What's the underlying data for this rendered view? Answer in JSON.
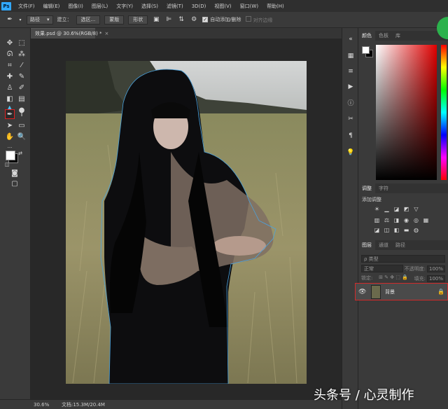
{
  "app": {
    "logo": "Ps"
  },
  "menu": [
    "文件(F)",
    "编辑(E)",
    "图像(I)",
    "图层(L)",
    "文字(Y)",
    "选择(S)",
    "滤镜(T)",
    "3D(D)",
    "视图(V)",
    "窗口(W)",
    "帮助(H)"
  ],
  "options": {
    "mode_value": "路径",
    "build_label": "建立：",
    "selection_button": "选区...",
    "mask_button": "蒙版",
    "shape_button": "形状",
    "auto_add_delete": "自动添加/删除",
    "align_edges": "对齐边缘"
  },
  "document": {
    "tab_title": "效果.psd @ 30.6%(RGB/8) *",
    "close": "×"
  },
  "status": {
    "zoom": "30.6%",
    "doc_size": "文档:15.3M/20.4M"
  },
  "panels": {
    "color_tabs": [
      "颜色",
      "色板",
      "库"
    ],
    "adjust_tabs": [
      "调整",
      "字符"
    ],
    "adjust_title": "添加调整",
    "layers_tabs": [
      "图层",
      "通道",
      "路径"
    ],
    "layer_filter": "ρ 类型",
    "blend_mode": "正常",
    "opacity_label": "不透明度:",
    "opacity_value": "100%",
    "lock_label": "锁定:",
    "fill_label": "填充:",
    "fill_value": "100%",
    "layer_name": "背景"
  },
  "watermark": "头条号 / 心灵制作"
}
